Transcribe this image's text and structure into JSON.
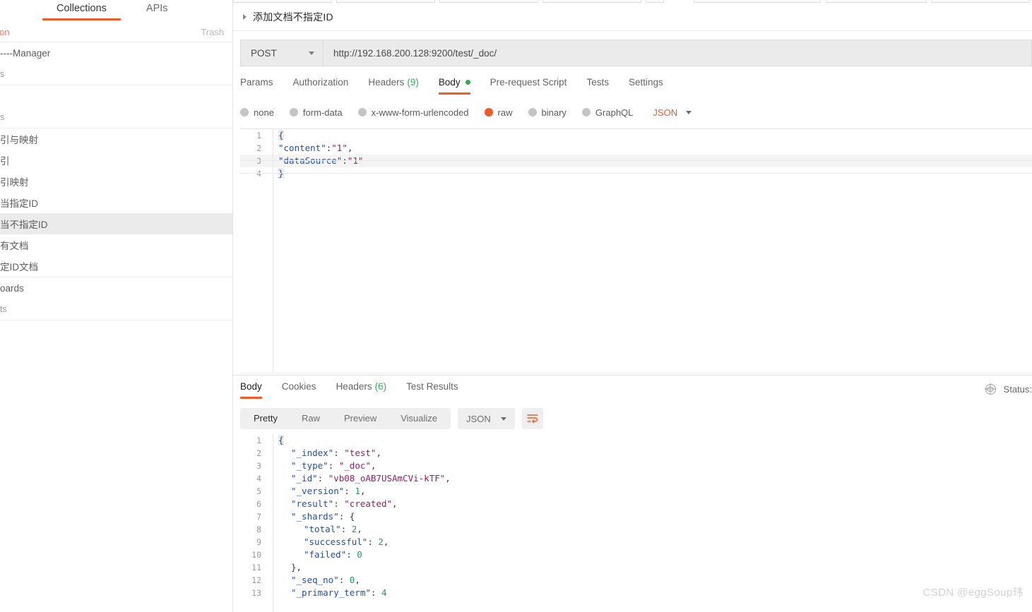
{
  "sidebar": {
    "tabs": [
      {
        "label": "Collections",
        "active": true
      },
      {
        "label": "APIs",
        "active": false
      }
    ],
    "sub": {
      "new_collection_label": "ction",
      "trash_label": "Trash"
    },
    "groups": [
      {
        "rows": [
          {
            "label": "----Manager",
            "dim": false,
            "selected": false
          },
          {
            "label": "s",
            "dim": true,
            "selected": false
          }
        ]
      },
      {
        "rows": [
          {
            "label": "",
            "dim": false,
            "selected": false
          },
          {
            "label": "s",
            "dim": true,
            "selected": false
          }
        ]
      },
      {
        "rows": [
          {
            "label": "引与映射",
            "dim": false,
            "selected": false
          },
          {
            "label": "引",
            "dim": false,
            "selected": false
          },
          {
            "label": "引映射",
            "dim": false,
            "selected": false
          },
          {
            "label": "当指定ID",
            "dim": false,
            "selected": false
          },
          {
            "label": "当不指定ID",
            "dim": false,
            "selected": true
          },
          {
            "label": "有文档",
            "dim": false,
            "selected": false
          },
          {
            "label": "定ID文档",
            "dim": false,
            "selected": false
          }
        ]
      },
      {
        "rows": [
          {
            "label": "oards",
            "dim": false,
            "selected": false
          },
          {
            "label": "ts",
            "dim": true,
            "selected": false
          }
        ]
      }
    ]
  },
  "request": {
    "name": "添加文档不指定ID",
    "method": "POST",
    "url": "http://192.168.200.128:9200/test/_doc/",
    "tabs": [
      {
        "label": "Params",
        "active": false,
        "count": "",
        "dot": false
      },
      {
        "label": "Authorization",
        "active": false,
        "count": "",
        "dot": false
      },
      {
        "label": "Headers",
        "active": false,
        "count": "(9)",
        "dot": false
      },
      {
        "label": "Body",
        "active": true,
        "count": "",
        "dot": true
      },
      {
        "label": "Pre-request Script",
        "active": false,
        "count": "",
        "dot": false
      },
      {
        "label": "Tests",
        "active": false,
        "count": "",
        "dot": false
      },
      {
        "label": "Settings",
        "active": false,
        "count": "",
        "dot": false
      }
    ],
    "body_types": [
      {
        "label": "none",
        "selected": false
      },
      {
        "label": "form-data",
        "selected": false
      },
      {
        "label": "x-www-form-urlencoded",
        "selected": false
      },
      {
        "label": "raw",
        "selected": true
      },
      {
        "label": "binary",
        "selected": false
      },
      {
        "label": "GraphQL",
        "selected": false
      }
    ],
    "body_format": "JSON",
    "body_lines": [
      {
        "n": "1",
        "tokens": [
          {
            "t": "{",
            "c": "jbrace"
          }
        ]
      },
      {
        "n": "2",
        "tokens": [
          {
            "t": "\"content\"",
            "c": "jstr"
          },
          {
            "t": ":",
            "c": "jpun"
          },
          {
            "t": "\"1\"",
            "c": "jkey"
          },
          {
            "t": ",",
            "c": "jpun"
          }
        ]
      },
      {
        "n": "3",
        "tokens": [
          {
            "t": "\"dataSource\"",
            "c": "jstr"
          },
          {
            "t": ":",
            "c": "jpun"
          },
          {
            "t": "\"1\"",
            "c": "jkey"
          }
        ]
      },
      {
        "n": "4",
        "tokens": [
          {
            "t": "}",
            "c": "jbrace"
          }
        ]
      }
    ]
  },
  "response": {
    "tabs": [
      {
        "label": "Body",
        "active": true,
        "count": ""
      },
      {
        "label": "Cookies",
        "active": false,
        "count": ""
      },
      {
        "label": "Headers",
        "active": false,
        "count": "(6)"
      },
      {
        "label": "Test Results",
        "active": false,
        "count": ""
      }
    ],
    "status_label": "Status:",
    "format_tabs": [
      {
        "label": "Pretty",
        "active": true
      },
      {
        "label": "Raw",
        "active": false
      },
      {
        "label": "Preview",
        "active": false
      },
      {
        "label": "Visualize",
        "active": false
      }
    ],
    "format_select": "JSON",
    "body_lines": [
      {
        "n": "1",
        "ind": 0,
        "tokens": [
          {
            "t": "{",
            "c": "jbrace"
          }
        ]
      },
      {
        "n": "2",
        "ind": 1,
        "tokens": [
          {
            "t": "\"_index\"",
            "c": "jstr"
          },
          {
            "t": ": ",
            "c": "jpun"
          },
          {
            "t": "\"test\"",
            "c": "jkey"
          },
          {
            "t": ",",
            "c": "jpun"
          }
        ]
      },
      {
        "n": "3",
        "ind": 1,
        "tokens": [
          {
            "t": "\"_type\"",
            "c": "jstr"
          },
          {
            "t": ": ",
            "c": "jpun"
          },
          {
            "t": "\"_doc\"",
            "c": "jkey"
          },
          {
            "t": ",",
            "c": "jpun"
          }
        ]
      },
      {
        "n": "4",
        "ind": 1,
        "tokens": [
          {
            "t": "\"_id\"",
            "c": "jstr"
          },
          {
            "t": ": ",
            "c": "jpun"
          },
          {
            "t": "\"vb08_oAB7USAmCVi-kTF\"",
            "c": "jkey"
          },
          {
            "t": ",",
            "c": "jpun"
          }
        ]
      },
      {
        "n": "5",
        "ind": 1,
        "tokens": [
          {
            "t": "\"_version\"",
            "c": "jstr"
          },
          {
            "t": ": ",
            "c": "jpun"
          },
          {
            "t": "1",
            "c": "jnum"
          },
          {
            "t": ",",
            "c": "jpun"
          }
        ]
      },
      {
        "n": "6",
        "ind": 1,
        "tokens": [
          {
            "t": "\"result\"",
            "c": "jstr"
          },
          {
            "t": ": ",
            "c": "jpun"
          },
          {
            "t": "\"created\"",
            "c": "jkey"
          },
          {
            "t": ",",
            "c": "jpun"
          }
        ]
      },
      {
        "n": "7",
        "ind": 1,
        "tokens": [
          {
            "t": "\"_shards\"",
            "c": "jstr"
          },
          {
            "t": ": ",
            "c": "jpun"
          },
          {
            "t": "{",
            "c": "jpun"
          }
        ]
      },
      {
        "n": "8",
        "ind": 2,
        "tokens": [
          {
            "t": "\"total\"",
            "c": "jstr"
          },
          {
            "t": ": ",
            "c": "jpun"
          },
          {
            "t": "2",
            "c": "jnum"
          },
          {
            "t": ",",
            "c": "jpun"
          }
        ]
      },
      {
        "n": "9",
        "ind": 2,
        "tokens": [
          {
            "t": "\"successful\"",
            "c": "jstr"
          },
          {
            "t": ": ",
            "c": "jpun"
          },
          {
            "t": "2",
            "c": "jnum"
          },
          {
            "t": ",",
            "c": "jpun"
          }
        ]
      },
      {
        "n": "10",
        "ind": 2,
        "tokens": [
          {
            "t": "\"failed\"",
            "c": "jstr"
          },
          {
            "t": ": ",
            "c": "jpun"
          },
          {
            "t": "0",
            "c": "jnum"
          }
        ]
      },
      {
        "n": "11",
        "ind": 1,
        "tokens": [
          {
            "t": "},",
            "c": "jpun"
          }
        ]
      },
      {
        "n": "12",
        "ind": 1,
        "tokens": [
          {
            "t": "\"_seq_no\"",
            "c": "jstr"
          },
          {
            "t": ": ",
            "c": "jpun"
          },
          {
            "t": "0",
            "c": "jnum"
          },
          {
            "t": ",",
            "c": "jpun"
          }
        ]
      },
      {
        "n": "13",
        "ind": 1,
        "tokens": [
          {
            "t": "\"_primary_term\"",
            "c": "jstr"
          },
          {
            "t": ": ",
            "c": "jpun"
          },
          {
            "t": "4",
            "c": "jnum"
          }
        ]
      }
    ]
  },
  "watermark": "CSDN @eggSoup玮",
  "colors": {
    "accent": "#ef5b25",
    "green": "#2fa84f",
    "tab_active_text": "#212121",
    "muted_text": "#9a9a9a"
  }
}
